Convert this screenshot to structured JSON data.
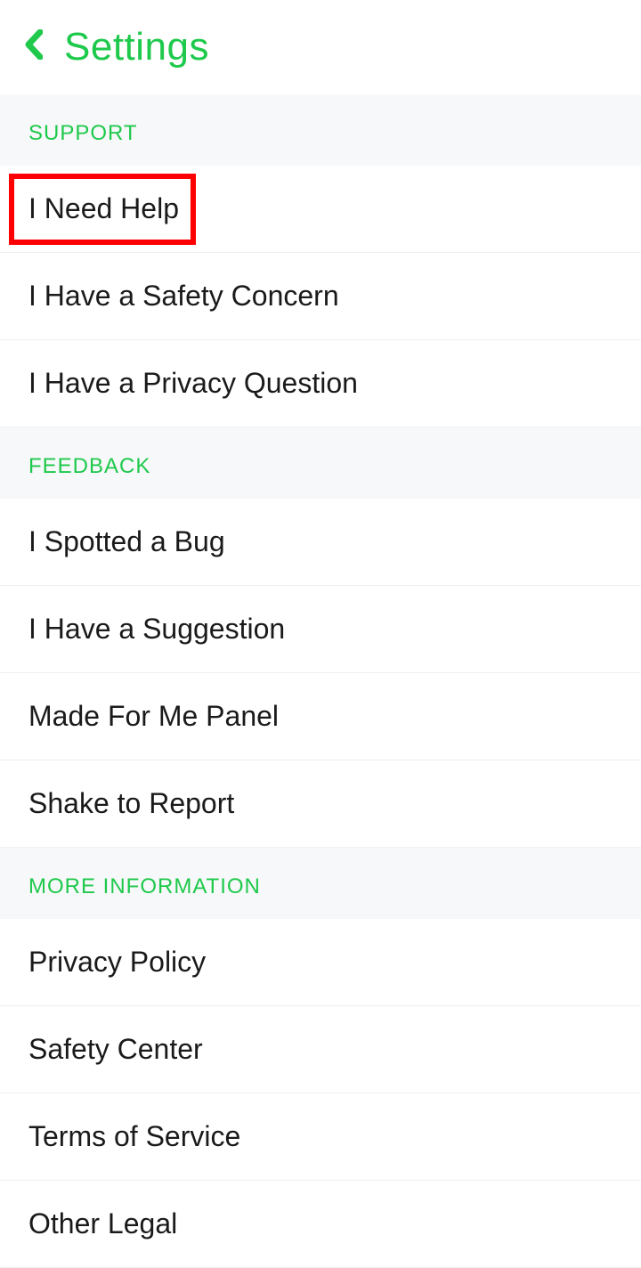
{
  "header": {
    "title": "Settings"
  },
  "sections": [
    {
      "title": "SUPPORT",
      "items": [
        {
          "label": "I Need Help",
          "highlighted": true
        },
        {
          "label": "I Have a Safety Concern"
        },
        {
          "label": "I Have a Privacy Question"
        }
      ]
    },
    {
      "title": "FEEDBACK",
      "items": [
        {
          "label": "I Spotted a Bug"
        },
        {
          "label": "I Have a Suggestion"
        },
        {
          "label": "Made For Me Panel"
        },
        {
          "label": "Shake to Report"
        }
      ]
    },
    {
      "title": "MORE INFORMATION",
      "items": [
        {
          "label": "Privacy Policy"
        },
        {
          "label": "Safety Center"
        },
        {
          "label": "Terms of Service"
        },
        {
          "label": "Other Legal"
        }
      ]
    }
  ],
  "colors": {
    "accent": "#1ec94b",
    "highlight": "#ff0000"
  }
}
